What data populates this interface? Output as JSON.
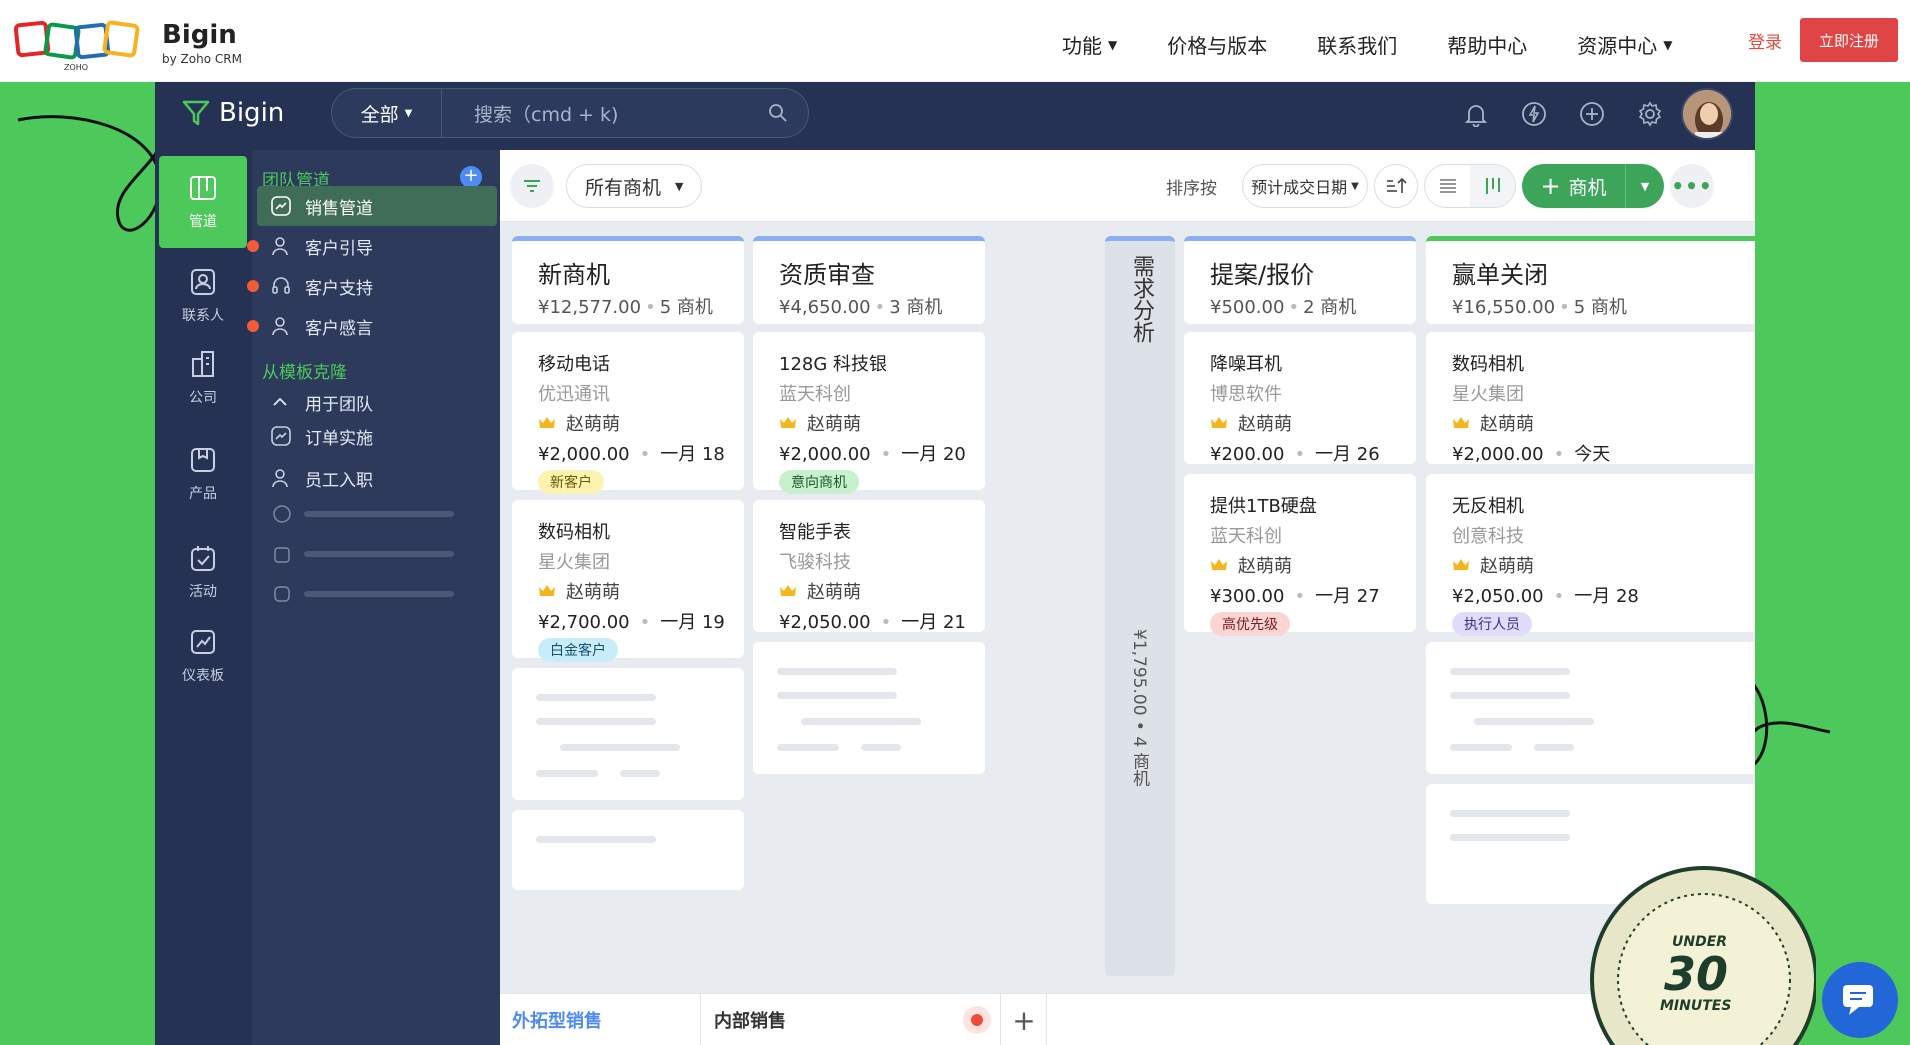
{
  "topnav": {
    "brand_name": "Bigin",
    "brand_sub": "by Zoho CRM",
    "links": [
      {
        "label": "功能",
        "has_caret": true
      },
      {
        "label": "价格与版本",
        "has_caret": false
      },
      {
        "label": "联系我们",
        "has_caret": false
      },
      {
        "label": "帮助中心",
        "has_caret": false
      },
      {
        "label": "资源中心",
        "has_caret": true
      }
    ],
    "login": "登录",
    "signup": "立即注册"
  },
  "app": {
    "logo": "Bigin",
    "search_scope": "全部",
    "search_placeholder": "搜索（cmd + k)",
    "top_icons": [
      "bell-icon",
      "lightning-icon",
      "plus-circle-icon",
      "gear-icon"
    ]
  },
  "iconbar": [
    {
      "label": "管道",
      "icon": "pipeline-icon",
      "active": true
    },
    {
      "label": "联系人",
      "icon": "contact-icon",
      "active": false
    },
    {
      "label": "公司",
      "icon": "company-icon",
      "active": false
    },
    {
      "label": "产品",
      "icon": "product-icon",
      "active": false
    },
    {
      "label": "活动",
      "icon": "activity-icon",
      "active": false
    },
    {
      "label": "仪表板",
      "icon": "dashboard-icon",
      "active": false
    }
  ],
  "subbar": {
    "team_header": "团队管道",
    "items": [
      {
        "label": "销售管道",
        "active": true,
        "dot": false
      },
      {
        "label": "客户引导",
        "active": false,
        "dot": true
      },
      {
        "label": "客户支持",
        "active": false,
        "dot": true
      },
      {
        "label": "客户感言",
        "active": false,
        "dot": true
      }
    ],
    "template_header": "从模板克隆",
    "template_group": "用于团队",
    "template_items": [
      "订单实施",
      "员工入职"
    ]
  },
  "toolbar": {
    "view": "所有商机",
    "sort_label": "排序按",
    "sort_value": "预计成交日期",
    "add_label": "商机"
  },
  "stages": [
    {
      "name": "新商机",
      "amount": "¥12,577.00",
      "count": "5 商机",
      "cards": [
        {
          "title": "移动电话",
          "company": "优迅通讯",
          "owner": "赵萌萌",
          "amount": "¥2,000.00",
          "date": "一月 18",
          "tag": "新客户",
          "tag_color": "#fdf3b0",
          "tag_text": "#6b5a00"
        },
        {
          "title": "数码相机",
          "company": "星火集团",
          "owner": "赵萌萌",
          "amount": "¥2,700.00",
          "date": "一月 19",
          "tag": "白金客户",
          "tag_color": "#c9ecfb",
          "tag_text": "#14536e"
        }
      ]
    },
    {
      "name": "资质审查",
      "amount": "¥4,650.00",
      "count": "3 商机",
      "cards": [
        {
          "title": "128G 科技银",
          "company": "蓝天科创",
          "owner": "赵萌萌",
          "amount": "¥2,000.00",
          "date": "一月 20",
          "tag": "意向商机",
          "tag_color": "#c8f0cf",
          "tag_text": "#1a5a28"
        },
        {
          "title": "智能手表",
          "company": "飞骏科技",
          "owner": "赵萌萌",
          "amount": "¥2,050.00",
          "date": "一月 21",
          "tag": "",
          "tag_color": "",
          "tag_text": ""
        }
      ]
    },
    {
      "name": "提案/报价",
      "amount": "¥500.00",
      "count": "2 商机",
      "cards": [
        {
          "title": "降噪耳机",
          "company": "博思软件",
          "owner": "赵萌萌",
          "amount": "¥200.00",
          "date": "一月 26",
          "tag": "",
          "tag_color": "",
          "tag_text": ""
        },
        {
          "title": "提供1TB硬盘",
          "company": "蓝天科创",
          "owner": "赵萌萌",
          "amount": "¥300.00",
          "date": "一月 27",
          "tag": "高优先级",
          "tag_color": "#fbd4d4",
          "tag_text": "#7a1f1f"
        }
      ]
    },
    {
      "name": "赢单关闭",
      "amount": "¥16,550.00",
      "count": "5 商机",
      "cards": [
        {
          "title": "数码相机",
          "company": "星火集团",
          "owner": "赵萌萌",
          "amount": "¥2,000.00",
          "date": "今天",
          "tag": "",
          "tag_color": "",
          "tag_text": ""
        },
        {
          "title": "无反相机",
          "company": "创意科技",
          "owner": "赵萌萌",
          "amount": "¥2,050.00",
          "date": "一月 28",
          "tag": "执行人员",
          "tag_color": "#e2dcfb",
          "tag_text": "#3f2f8a"
        }
      ]
    }
  ],
  "collapsed_stage": {
    "name": "需求分析",
    "summary": "¥1,795.00 • 4 商机"
  },
  "tabs": {
    "items": [
      "外拓型销售",
      "内部销售"
    ]
  },
  "badge": {
    "under": "UNDER",
    "number": "30",
    "minutes": "MINUTES"
  },
  "colors": {
    "green": "#4cc95a",
    "navy": "#263253",
    "accent_blue": "#4f8bf5",
    "add_green": "#3da55a",
    "signup_red": "#e04545"
  }
}
